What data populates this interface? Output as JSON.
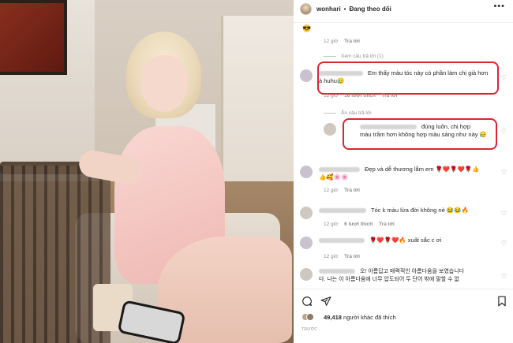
{
  "header": {
    "username": "wonhari",
    "dot": "•",
    "follow_status": "Đang theo dõi",
    "more": "•••"
  },
  "comments": {
    "emoji_top": "😎",
    "meta1_time": "12 giờ",
    "meta1_reply": "Trả lời",
    "view_replies": "Xem câu trả lời (1)",
    "c1_text": "Em thấy màu tóc này có phần làm chị già hơn á huhu😥",
    "c1_time": "12 giờ",
    "c1_likes": "16 lượt thích",
    "c1_reply": "Trả lời",
    "hide_replies": "Ẩn câu trả lời",
    "c2_text_a": "đúng luôn, chị hợp",
    "c2_text_b": "màu trầm hơn không hợp màu sáng như này 😥",
    "c3_text": "Đẹp và dễ thương lắm em 🌹❤️🌹❤️🌹👍",
    "c3_emojis": "👍🥰🌸🌸",
    "c3_time": "12 giờ",
    "c3_reply": "Trả lời",
    "c4_text": "Tóc k màu lửa đời không nè 😂😂🔥",
    "c4_time": "12 giờ",
    "c4_likes": "6 lượt thích",
    "c4_reply": "Trả lời",
    "c5_text": "🌹❤️🌹❤️🔥 xuất sắc c ơi",
    "c5_time": "12 giờ",
    "c5_reply": "Trả lời",
    "c6_text_a": "오! 아름답고 매력적인 아름다움을 보였습니다",
    "c6_text_b": "다. 나는 이 아름다움에 너무 압도되어 두 단어 밖에 말할 수 없"
  },
  "actions": {
    "like_count": "49,418",
    "likes_suffix": "người khác đã thích",
    "time_ago": "TRƯỚC"
  },
  "colors": {
    "highlight": "#e0242f",
    "muted_text": "#8e8e8e"
  }
}
